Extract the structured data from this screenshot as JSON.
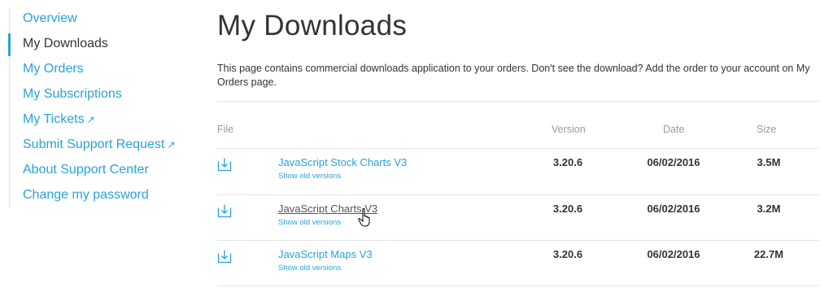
{
  "sidebar": {
    "items": [
      {
        "label": "Overview",
        "external": false,
        "active": false
      },
      {
        "label": "My Downloads",
        "external": false,
        "active": true
      },
      {
        "label": "My Orders",
        "external": false,
        "active": false
      },
      {
        "label": "My Subscriptions",
        "external": false,
        "active": false
      },
      {
        "label": "My Tickets",
        "external": true,
        "active": false
      },
      {
        "label": "Submit Support Request",
        "external": true,
        "active": false
      },
      {
        "label": "About Support Center",
        "external": false,
        "active": false
      },
      {
        "label": "Change my password",
        "external": false,
        "active": false
      }
    ],
    "external_glyph": "↗"
  },
  "main": {
    "title": "My Downloads",
    "intro": "This page contains commercial downloads application to your orders. Don't see the download? Add the order to your account on My Orders page.",
    "table": {
      "headers": {
        "file": "File",
        "version": "Version",
        "date": "Date",
        "size": "Size"
      },
      "rows": [
        {
          "name": "JavaScript Stock Charts V3",
          "old": "Show old versions",
          "version": "3.20.6",
          "date": "06/02/2016",
          "size": "3.5M"
        },
        {
          "name": "JavaScript Charts V3",
          "old": "Show old versions",
          "version": "3.20.6",
          "date": "06/02/2016",
          "size": "3.2M"
        },
        {
          "name": "JavaScript Maps V3",
          "old": "Show old versions",
          "version": "3.20.6",
          "date": "06/02/2016",
          "size": "22.7M"
        }
      ]
    }
  },
  "colors": {
    "accent": "#2aa2d8",
    "text": "#333333",
    "muted": "#999999",
    "rule": "#e3e3e3"
  },
  "icons": {
    "download": "download-icon",
    "cursor": "hand-pointer-icon"
  }
}
